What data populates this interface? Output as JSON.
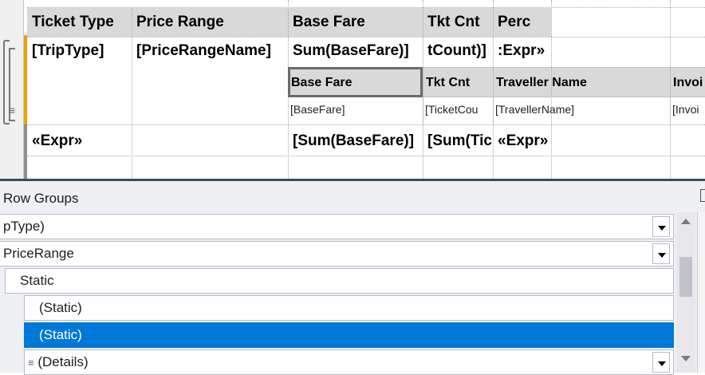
{
  "designer": {
    "header": [
      "Ticket Type",
      "Price Range",
      "Base Fare",
      "Tkt Cnt",
      "Perc"
    ],
    "row1": [
      "[TripType]",
      "[PriceRangeName]",
      "Sum(BaseFare)]",
      "tCount)]",
      ":Expr»"
    ],
    "sub_header": [
      "Base Fare",
      "Tkt Cnt",
      "Traveller Name",
      "Invoi"
    ],
    "sub_detail": [
      "[BaseFare]",
      "[TicketCou",
      "[TravellerName]",
      "[Invoi"
    ],
    "total": [
      "«Expr»",
      "[Sum(BaseFare)]",
      "[Sum(Tic",
      "«Expr»"
    ]
  },
  "row_groups": {
    "title": "Row Groups",
    "rows": [
      {
        "label": "pType)",
        "dropdown": true
      },
      {
        "label": "PriceRange",
        "dropdown": true
      },
      {
        "label": "Static",
        "dropdown": false
      },
      {
        "label": "(Static)",
        "dropdown": false
      },
      {
        "label": "(Static)",
        "dropdown": false,
        "selected": true
      },
      {
        "label": "(Details)",
        "dropdown": true
      }
    ]
  },
  "colors": {
    "selection": "#0078d7",
    "header_bg": "#d9d9d9",
    "panel_border": "#3d4a63"
  }
}
